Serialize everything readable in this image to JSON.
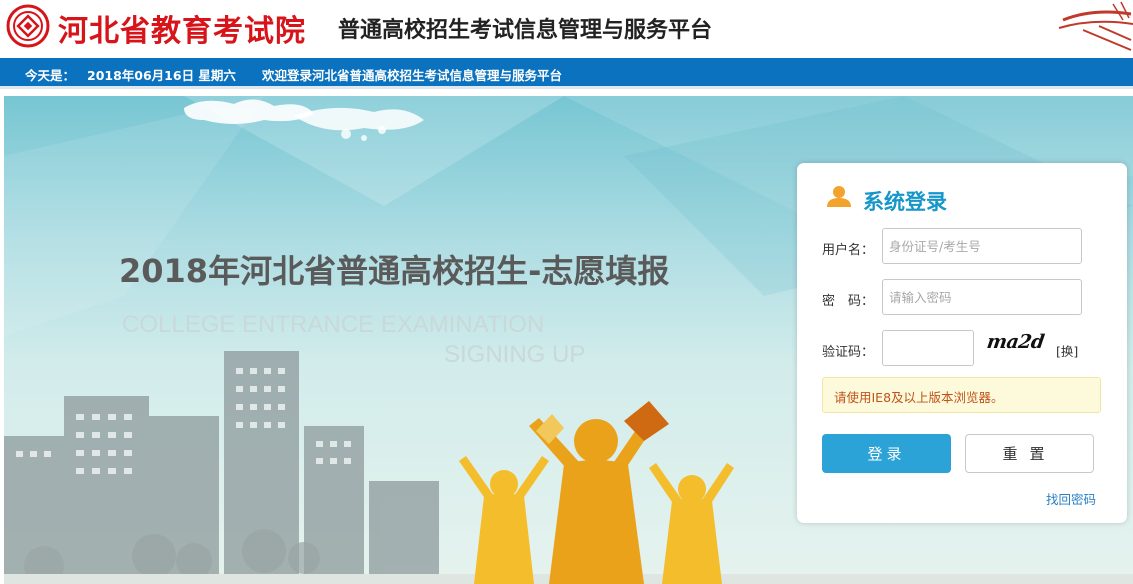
{
  "header": {
    "org_name": "河北省教育考试院",
    "platform_name": "普通高校招生考试信息管理与服务平台"
  },
  "bluebar": {
    "date_label": "今天是：",
    "date_value": "2018年06月16日 星期六",
    "welcome": "欢迎登录河北省普通高校招生考试信息管理与服务平台"
  },
  "banner": {
    "title": "2018年河北省普通高校招生-志愿填报",
    "subtitle_line1": "COLLEGE ENTRANCE EXAMINATION",
    "subtitle_line2": "SIGNING UP"
  },
  "login": {
    "title": "系统登录",
    "username_label": "用户名：",
    "username_placeholder": "身份证号/考生号",
    "password_label": "密　码：",
    "password_placeholder": "请输入密码",
    "captcha_label": "验证码：",
    "captcha_text": "ma2d",
    "refresh_link": "[换]",
    "notice": "请使用IE8及以上版本浏览器。",
    "login_button": "登录",
    "reset_button": "重置",
    "forgot_link": "找回密码"
  },
  "colors": {
    "brand_red": "#d8141b",
    "bar_blue": "#0a72be",
    "accent_blue": "#2ba3d7",
    "notice_text": "#c0531a"
  }
}
